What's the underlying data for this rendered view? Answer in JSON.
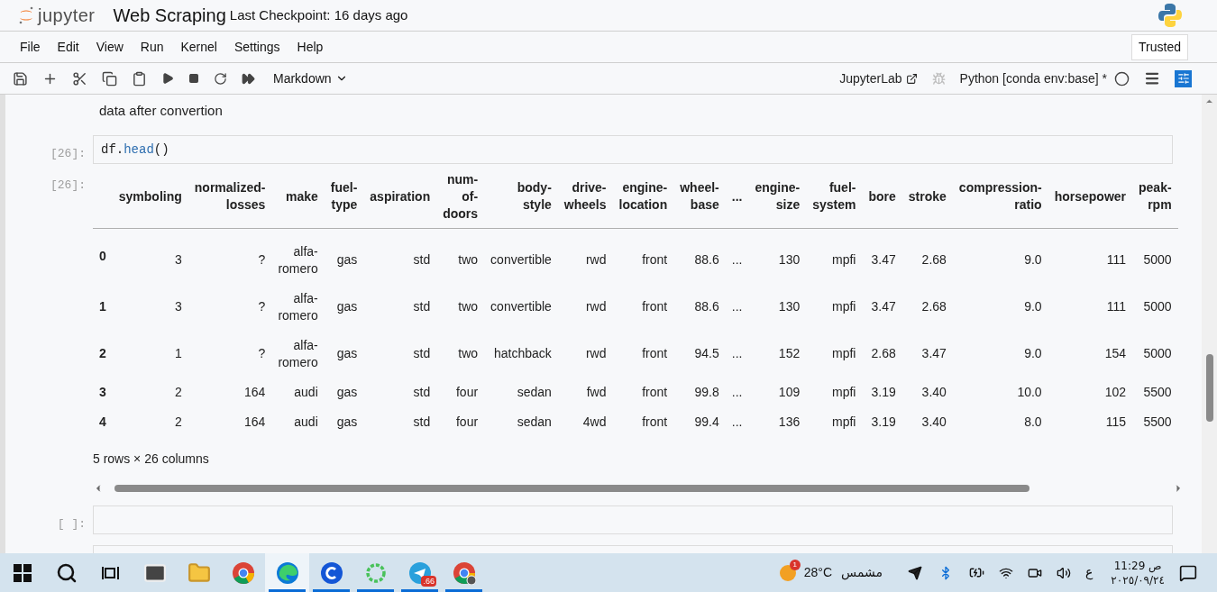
{
  "header": {
    "logo_text": "jupyter",
    "title": "Web Scraping",
    "checkpoint": "Last Checkpoint: 16 days ago"
  },
  "menu": [
    "File",
    "Edit",
    "View",
    "Run",
    "Kernel",
    "Settings",
    "Help"
  ],
  "trusted": "Trusted",
  "toolbar": {
    "cell_type": "Markdown",
    "open_in": "JupyterLab",
    "kernel": "Python [conda env:base] *"
  },
  "cells": [
    {
      "kind": "markdown",
      "text": "data after convertion"
    },
    {
      "kind": "code",
      "prompt": "[26]:",
      "code": [
        {
          "kind": "plain",
          "text": "df."
        },
        {
          "kind": "method",
          "text": "head"
        },
        {
          "kind": "plain",
          "text": "()"
        }
      ],
      "output": {
        "prompt": "[26]:",
        "columns": [
          "",
          "symboling",
          "normalized-losses",
          "make",
          "fuel-type",
          "aspiration",
          "num-of-doors",
          "body-style",
          "drive-wheels",
          "engine-location",
          "wheel-base",
          "...",
          "engine-size",
          "fuel-system",
          "bore",
          "stroke",
          "compression-ratio",
          "horsepower",
          "peak-rpm"
        ],
        "rows": [
          {
            "cells": [
              "0",
              "3",
              "?",
              "alfa-romero",
              "gas",
              "std",
              "two",
              "convertible",
              "rwd",
              "front",
              "88.6",
              "...",
              "130",
              "mpfi",
              "3.47",
              "2.68",
              "9.0",
              "111",
              "5000"
            ]
          },
          {
            "cells": [
              "1",
              "3",
              "?",
              "alfa-romero",
              "gas",
              "std",
              "two",
              "convertible",
              "rwd",
              "front",
              "88.6",
              "...",
              "130",
              "mpfi",
              "3.47",
              "2.68",
              "9.0",
              "111",
              "5000"
            ]
          },
          {
            "cells": [
              "2",
              "1",
              "?",
              "alfa-romero",
              "gas",
              "std",
              "two",
              "hatchback",
              "rwd",
              "front",
              "94.5",
              "...",
              "152",
              "mpfi",
              "2.68",
              "3.47",
              "9.0",
              "154",
              "5000"
            ]
          },
          {
            "cells": [
              "3",
              "2",
              "164",
              "audi",
              "gas",
              "std",
              "four",
              "sedan",
              "fwd",
              "front",
              "99.8",
              "...",
              "109",
              "mpfi",
              "3.19",
              "3.40",
              "10.0",
              "102",
              "5500"
            ]
          },
          {
            "cells": [
              "4",
              "2",
              "164",
              "audi",
              "gas",
              "std",
              "four",
              "sedan",
              "4wd",
              "front",
              "99.4",
              "...",
              "136",
              "mpfi",
              "3.19",
              "3.40",
              "8.0",
              "115",
              "5500"
            ]
          }
        ],
        "summary": "5 rows × 26 columns"
      }
    },
    {
      "kind": "code",
      "prompt": "[ ]:"
    },
    {
      "kind": "code"
    }
  ],
  "taskbar": {
    "apps": [
      {
        "kind": "start",
        "running": false,
        "selected": false
      },
      {
        "kind": "search",
        "running": false,
        "selected": false
      },
      {
        "kind": "taskview",
        "running": false,
        "selected": false
      },
      {
        "kind": "mail",
        "running": false,
        "selected": false
      },
      {
        "kind": "folder",
        "running": false,
        "selected": false
      },
      {
        "kind": "chrome",
        "running": false,
        "selected": false
      },
      {
        "kind": "edge",
        "running": true,
        "selected": true
      },
      {
        "kind": "c-app",
        "running": true,
        "selected": false
      },
      {
        "kind": "ring",
        "running": true,
        "selected": false
      },
      {
        "kind": "telegram",
        "running": true,
        "selected": false,
        "badge": ".66"
      },
      {
        "kind": "chrome-profile",
        "running": true,
        "selected": false
      }
    ],
    "weather": {
      "badge": "1",
      "temp": "28°C",
      "text": "مشمس"
    },
    "language": "ع",
    "time": "11:29 ص",
    "date": "٢٠٢٥/٠٩/٢٤"
  }
}
